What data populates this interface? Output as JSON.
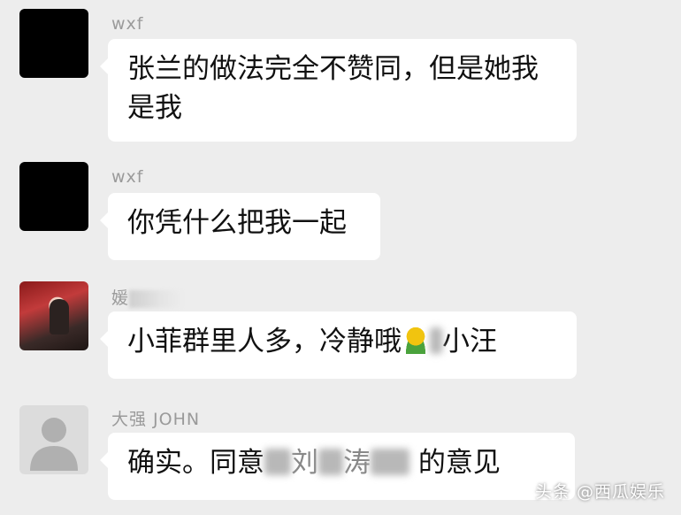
{
  "messages": [
    {
      "sender": "wxf",
      "avatar": "black-avatar",
      "text_line1": "张兰的做法完全不赞同，但是她我",
      "text_line2": "是我"
    },
    {
      "sender": "wxf",
      "avatar": "black-avatar",
      "text": "你凭什么把我一起"
    },
    {
      "sender_prefix": "媛",
      "avatar": "photo-avatar",
      "text_before_emoji": "小菲群里人多，冷静哦",
      "emoji": "blurred-emoji-icon",
      "text_after_emoji": "小汪"
    },
    {
      "sender": "大强 JOHN",
      "avatar": "default-person-icon",
      "text_before": "确实。同意",
      "text_obscured_1": "刘",
      "text_obscured_2": "涛",
      "text_after": "的意见"
    }
  ],
  "watermark": "头条 @西瓜娱乐"
}
